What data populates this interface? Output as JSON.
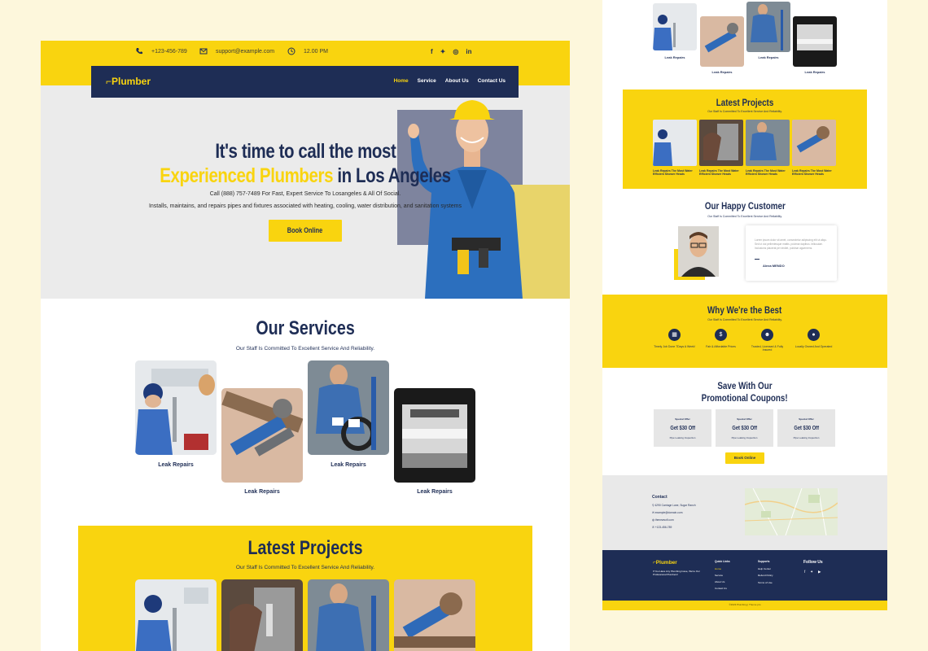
{
  "colors": {
    "accent": "#f9d40f",
    "navy": "#1e2d55",
    "background": "#fdf7dc"
  },
  "topbar": {
    "phone": "+123-456-789",
    "email": "support@example.com",
    "hours": "12.00 PM",
    "social": [
      "f",
      "t",
      "ig",
      "in"
    ]
  },
  "nav": {
    "logo": "Plumber",
    "links": [
      "Home",
      "Service",
      "About Us",
      "Contact Us"
    ]
  },
  "hero": {
    "title_line1": "It's time to call the most",
    "title_highlight": "Experienced Plumbers",
    "title_rest": "in Los Angeles",
    "call_text": "Call (888) 757-7489 For Fast, Expert Service To Losangeles & All Of Social.",
    "description": "Installs, maintains, and repairs pipes and fixtures associated with heating, cooling, water distribution, and sanitation systems",
    "cta": "Book Online"
  },
  "services": {
    "title": "Our Services",
    "subtitle": "Our Staff Is Committed To Excellent Service And Reliability.",
    "items": [
      "Leak Repairs",
      "Leak Repairs",
      "Leak Repairs",
      "Leak Repairs"
    ]
  },
  "projects": {
    "title": "Latest Projects",
    "subtitle": "Our Staff Is Committed To Excellent Service And Reliability.",
    "captions": [
      "Leak Repairs The Most Water Efficient Shower Heads",
      "Leak Repairs The Most Water Efficient Shower Heads",
      "Leak Repairs The Most Water Efficient Shower Heads",
      "Leak Repairs The Most Water Efficient Shower Heads"
    ]
  },
  "customer": {
    "title": "Our Happy Customer",
    "subtitle": "Our Staff Is Committed To Excellent Service And Reliability.",
    "quote": "Lorem ipsum dolor sit amet, consectetur adipiscing elit ut aliqu. Sed ut dui pellentesque mattis. pulvinar dapibus. tellusulae. Inclusions placerat per imdiet, pulvinar aguernens.",
    "name": "Alexa MENDO"
  },
  "why": {
    "title": "Why We're the Best",
    "subtitle": "Our Staff Is Committed To Excellent Service And Reliability.",
    "items": [
      {
        "icon": "calendar-icon",
        "label": "Timely Job Done 7Days A Week!"
      },
      {
        "icon": "dollar-icon",
        "label": "Fair & Affordable Prices"
      },
      {
        "icon": "users-icon",
        "label": "Trusted, Licensed & Fully Insured"
      },
      {
        "icon": "location-icon",
        "label": "Locally Owned And Operated"
      }
    ]
  },
  "coupons": {
    "title_line1": "Save With Our",
    "title_line2": "Promotional Coupons!",
    "items": [
      {
        "tag": "Special Offer",
        "amount": "Get $30 Off",
        "desc": "Pipe Leaking Inspection"
      },
      {
        "tag": "Special Offer",
        "amount": "Get $30 Off",
        "desc": "Pipe Leaking Inspection"
      },
      {
        "tag": "Special Offer",
        "amount": "Get $30 Off",
        "desc": "Pipe Leaking Inspection"
      }
    ],
    "cta": "Book Online"
  },
  "contact": {
    "title": "Contact",
    "address": "4290 Carriage Lane, Sugar Ranch",
    "email": "example@domain.com",
    "website": "thenewsofi.com",
    "phone": "+123-456-789"
  },
  "footer": {
    "logo": "Plumber",
    "tagline": "If You Have Any Plumbing Issue, We're Our Professional Plumbers!",
    "quick_links_title": "Quick Links",
    "quick_links": [
      "Home",
      "Service",
      "About Us",
      "Contact Us"
    ],
    "support_title": "Supports",
    "support_links": [
      "Help Center",
      "Refund Policy",
      "Terms of Use"
    ],
    "follow_title": "Follow Us",
    "copyright": "©2023 Plumbing | Theme pro"
  }
}
